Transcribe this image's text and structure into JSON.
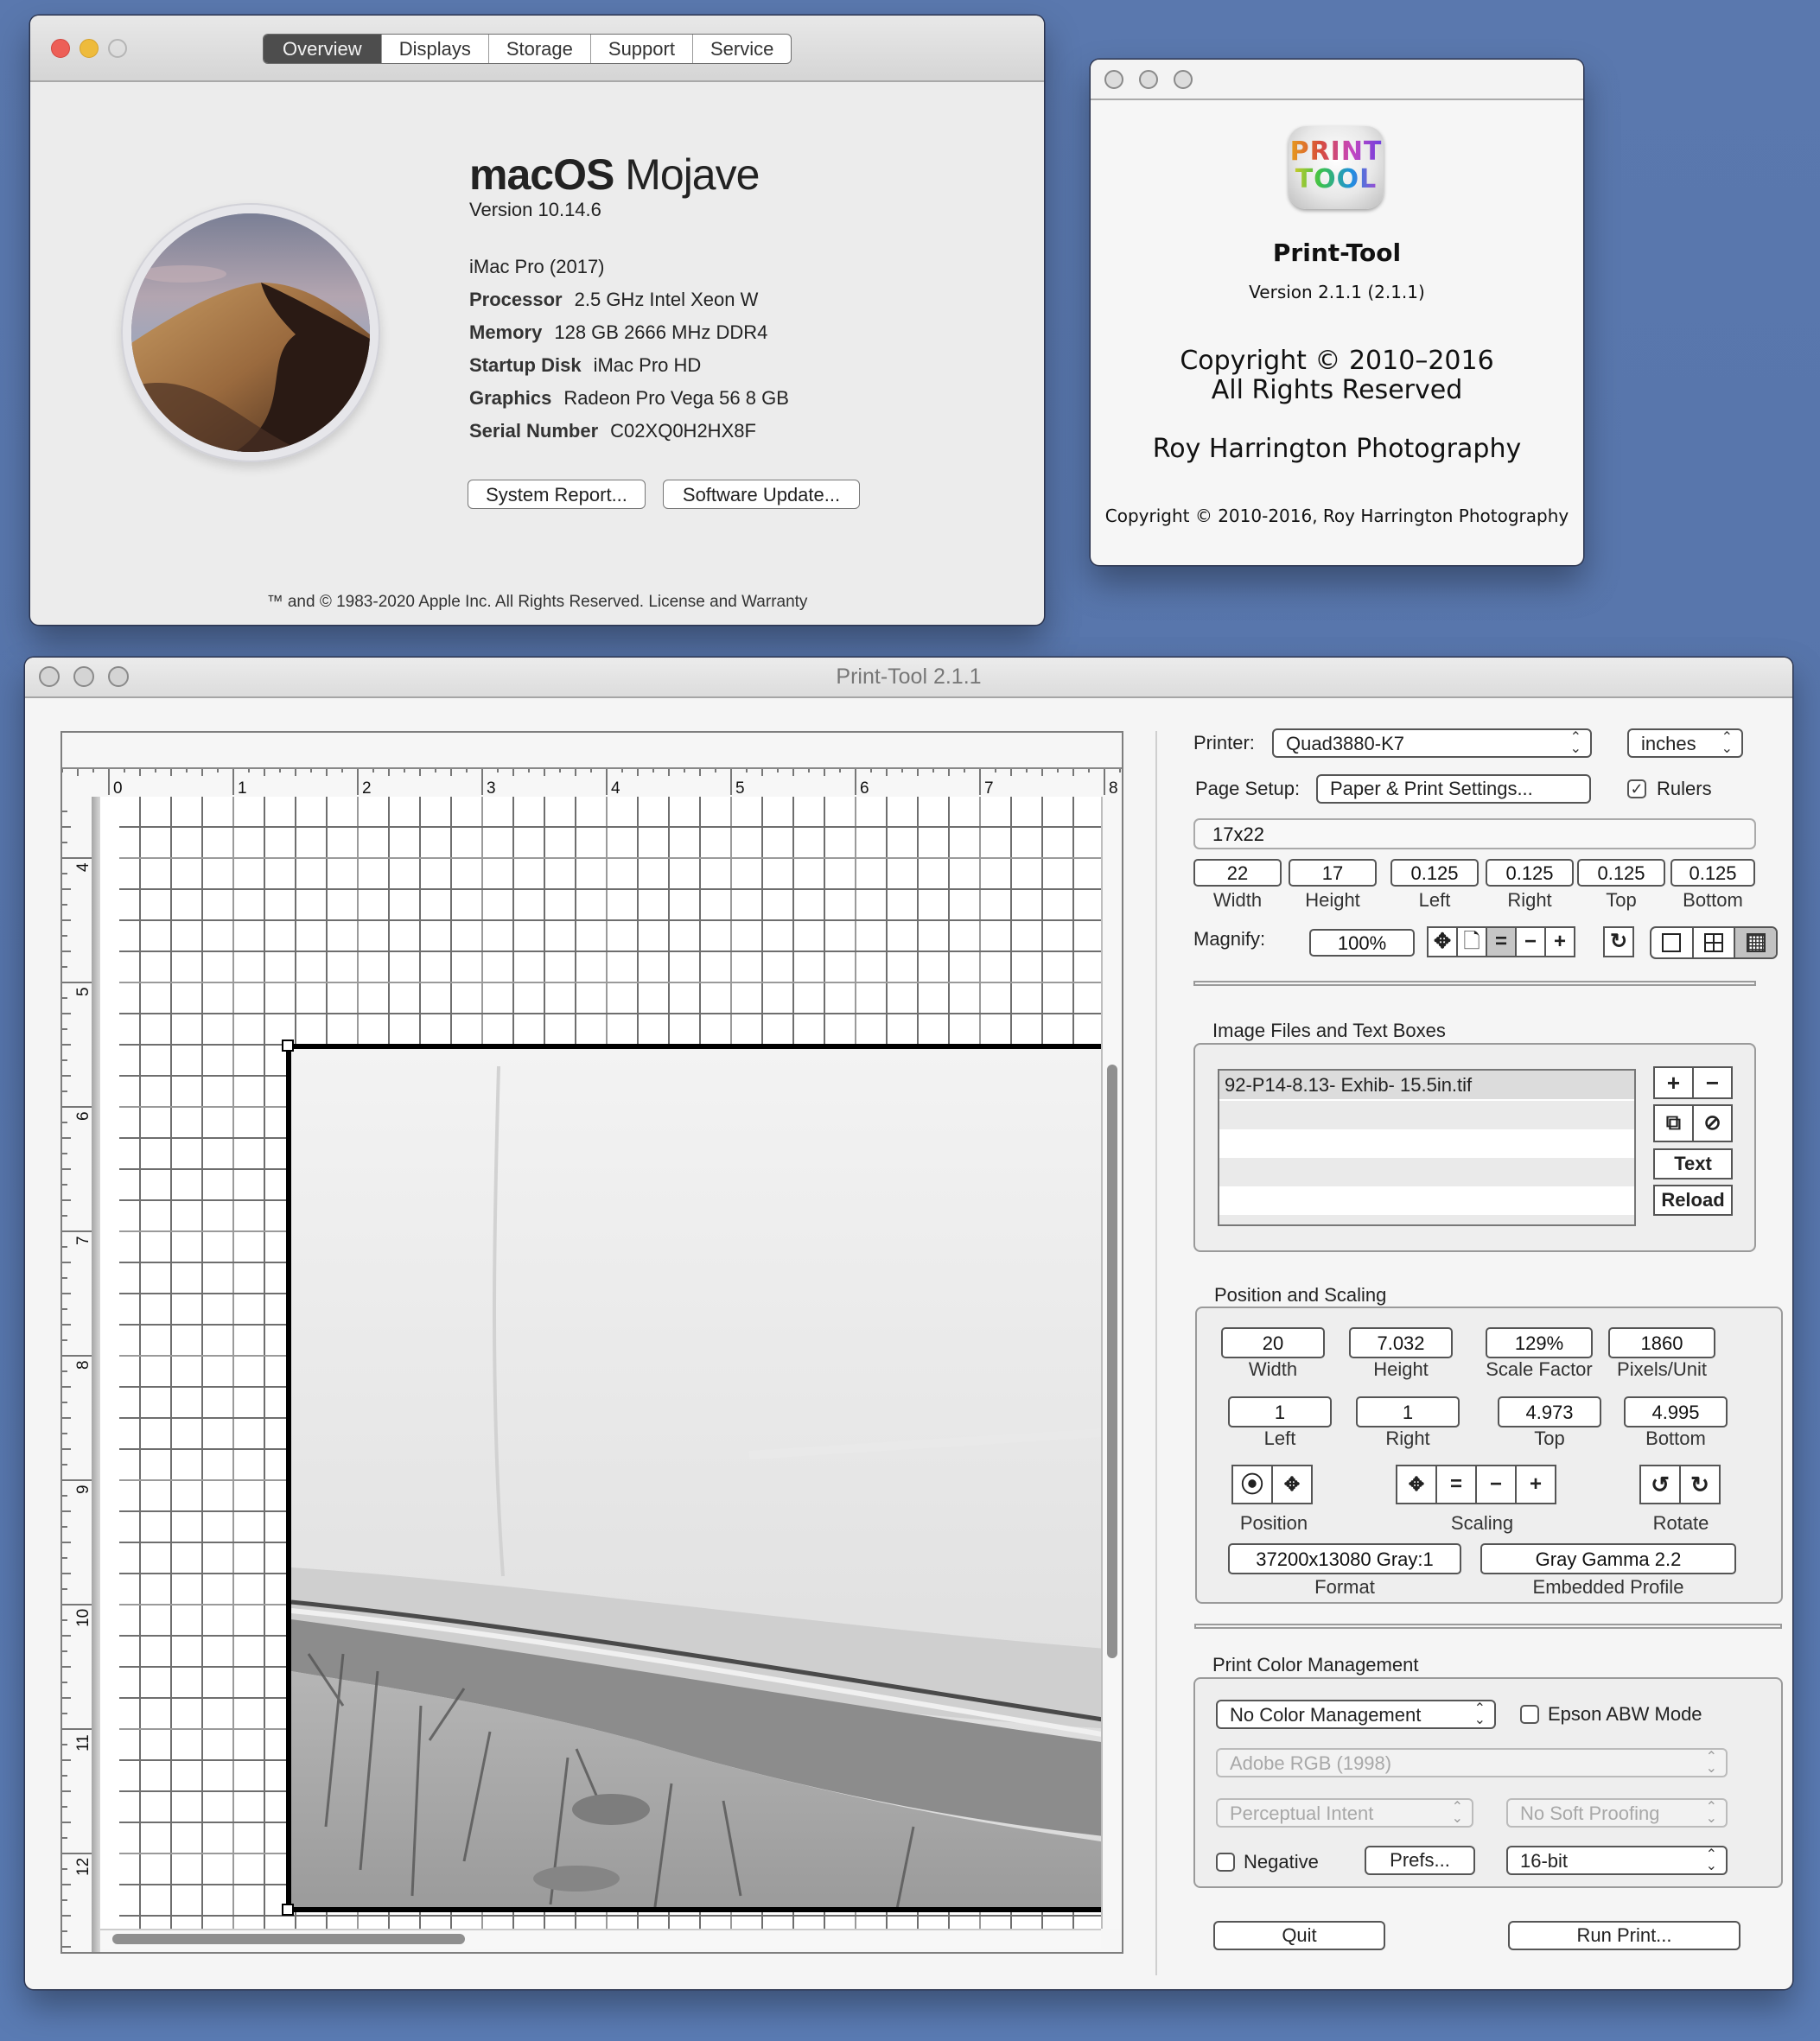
{
  "about_mac": {
    "tabs": [
      "Overview",
      "Displays",
      "Storage",
      "Support",
      "Service"
    ],
    "active_tab": "Overview",
    "os_name_bold": "macOS",
    "os_name_light": "Mojave",
    "version": "Version 10.14.6",
    "model": "iMac Pro (2017)",
    "specs": [
      {
        "key": "Processor",
        "value": "2.5 GHz Intel Xeon W"
      },
      {
        "key": "Memory",
        "value": "128 GB 2666 MHz DDR4"
      },
      {
        "key": "Startup Disk",
        "value": "iMac Pro HD"
      },
      {
        "key": "Graphics",
        "value": "Radeon Pro Vega 56 8 GB"
      },
      {
        "key": "Serial Number",
        "value": "C02XQ0H2HX8F"
      }
    ],
    "buttons": {
      "system_report": "System Report...",
      "software_update": "Software Update..."
    },
    "footer": "™ and © 1983-2020 Apple Inc. All Rights Reserved. License and Warranty",
    "traffic_colors": {
      "close": "#ed5f57",
      "minimize": "#eebb3c"
    }
  },
  "about_printtool": {
    "icon_text": [
      "PRINT",
      "TOOL"
    ],
    "app_name": "Print-Tool",
    "version": "Version 2.1.1 (2.1.1)",
    "copyright_line1": "Copyright © 2010–2016",
    "copyright_line2": "All Rights Reserved",
    "company": "Roy Harrington Photography",
    "footer": "Copyright © 2010-2016, Roy Harrington Photography"
  },
  "main": {
    "window_title": "Print-Tool 2.1.1",
    "rulers": {
      "horizontal": [
        "0",
        "1",
        "2",
        "3",
        "4",
        "5",
        "6",
        "7",
        "8"
      ],
      "vertical": [
        "4",
        "5",
        "6",
        "7",
        "8",
        "9",
        "10",
        "11",
        "12"
      ]
    },
    "printer": {
      "label": "Printer:",
      "value": "Quad3880-K7"
    },
    "units": {
      "value": "inches"
    },
    "page_setup": {
      "label": "Page Setup:",
      "button": "Paper & Print Settings..."
    },
    "rulers_checkbox": {
      "label": "Rulers",
      "checked": true
    },
    "paper_name": "17x22",
    "page_fields": [
      {
        "label": "Width",
        "value": "22"
      },
      {
        "label": "Height",
        "value": "17"
      },
      {
        "label": "Left",
        "value": "0.125"
      },
      {
        "label": "Right",
        "value": "0.125"
      },
      {
        "label": "Top",
        "value": "0.125"
      },
      {
        "label": "Bottom",
        "value": "0.125"
      }
    ],
    "magnify": {
      "label": "Magnify:",
      "value": "100%"
    },
    "magnify_tools": [
      "fit-move",
      "page",
      "equal",
      "minus",
      "plus"
    ],
    "magnify_active": "equal",
    "grid_modes": [
      "no-grid",
      "coarse-grid",
      "fine-grid"
    ],
    "grid_active": "fine-grid",
    "images_section": {
      "title": "Image Files and Text Boxes",
      "files": [
        "92-P14-8.13- Exhib- 15.5in.tif"
      ],
      "buttons": {
        "text": "Text",
        "reload": "Reload"
      }
    },
    "position_section": {
      "title": "Position and Scaling",
      "row1": [
        {
          "label": "Width",
          "value": "20"
        },
        {
          "label": "Height",
          "value": "7.032"
        },
        {
          "label": "Scale Factor",
          "value": "129%"
        },
        {
          "label": "Pixels/Unit",
          "value": "1860"
        }
      ],
      "row2": [
        {
          "label": "Left",
          "value": "1"
        },
        {
          "label": "Right",
          "value": "1"
        },
        {
          "label": "Top",
          "value": "4.973"
        },
        {
          "label": "Bottom",
          "value": "4.995"
        }
      ],
      "groups": {
        "position": "Position",
        "scaling": "Scaling",
        "rotate": "Rotate"
      },
      "format": {
        "label": "Format",
        "value": "37200x13080 Gray:1"
      },
      "profile": {
        "label": "Embedded Profile",
        "value": "Gray Gamma 2.2"
      }
    },
    "color_section": {
      "title": "Print Color Management",
      "mode": "No Color Management",
      "epson_abw": {
        "label": "Epson ABW Mode",
        "checked": false
      },
      "profile": "Adobe RGB (1998)",
      "intent": "Perceptual Intent",
      "soft_proof": "No Soft Proofing",
      "negative": {
        "label": "Negative",
        "checked": false
      },
      "prefs_button": "Prefs...",
      "bit_depth": "16-bit"
    },
    "quit_button": "Quit",
    "run_button": "Run Print..."
  }
}
